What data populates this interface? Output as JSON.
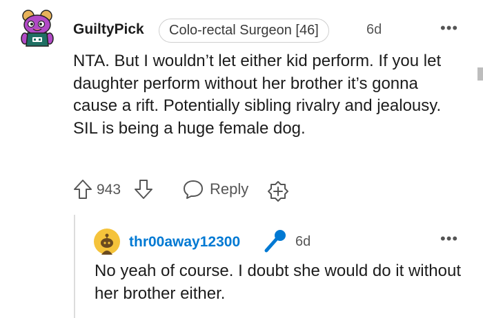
{
  "comment": {
    "username": "GuiltyPick",
    "flair": "Colo-rectal Surgeon [46]",
    "time": "6d",
    "more_icon": "more-dots-icon",
    "body": "NTA. But I wouldn’t let either kid perform. If you let daughter perform without her brother it’s gonna cause a rift. Potentially sibling rivalry and jealousy. SIL is being a huge female dog.",
    "score": "943",
    "reply_label": "Reply",
    "icons": {
      "avatar": "snoo-avatar-icon",
      "upvote": "upvote-arrow-icon",
      "downvote": "downvote-arrow-icon",
      "reply": "speech-bubble-icon",
      "award": "award-plus-icon"
    }
  },
  "reply": {
    "username": "thr00away12300",
    "time": "6d",
    "badge_icon": "microphone-icon",
    "body": "No yeah of course. I doubt she would do it without her brother either.",
    "avatar_icon": "default-snoo-avatar-icon"
  },
  "colors": {
    "op_username": "#0079d3",
    "text": "#1c1c1c",
    "meta": "#555555",
    "avatar_gold": "#f5c33b",
    "avatar_purple": "#b14ac6"
  }
}
